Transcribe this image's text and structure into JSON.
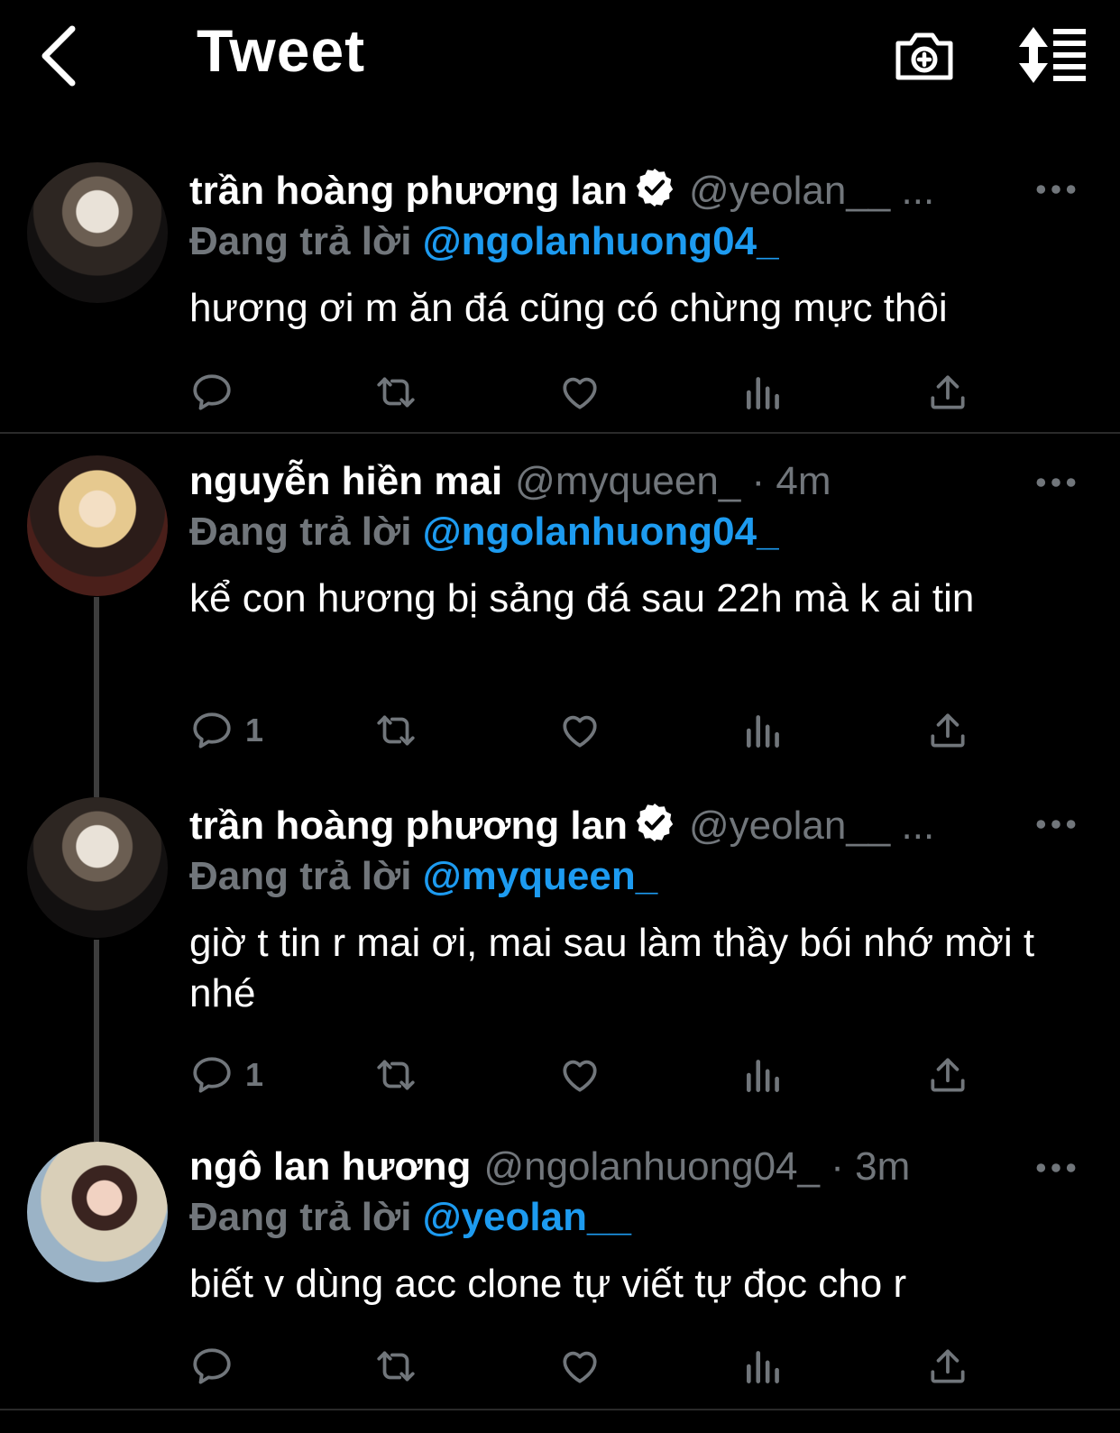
{
  "header": {
    "title": "Tweet"
  },
  "tweets": [
    {
      "name": "trần hoàng phương lan",
      "verified": true,
      "handle_time": "@yeolan__ ...",
      "reply_prefix": "Đang trả lời",
      "reply_to": "@ngolanhuong04_",
      "text": "hương ơi m ăn đá cũng có chừng mực thôi",
      "reply_count": ""
    },
    {
      "name": "nguyễn hiền mai",
      "verified": false,
      "handle_time": "@myqueen_ · 4m",
      "reply_prefix": "Đang trả lời",
      "reply_to": "@ngolanhuong04_",
      "text": "kể con hương bị sảng đá sau 22h mà k ai tin",
      "reply_count": "1"
    },
    {
      "name": "trần hoàng phương lan",
      "verified": true,
      "handle_time": "@yeolan__ ...",
      "reply_prefix": "Đang trả lời",
      "reply_to": "@myqueen_",
      "text": "giờ t tin r mai ơi, mai sau làm thầy bói nhớ mời t nhé",
      "reply_count": "1"
    },
    {
      "name": "ngô lan hương",
      "verified": false,
      "handle_time": "@ngolanhuong04_ · 3m",
      "reply_prefix": "Đang trả lời",
      "reply_to": "@yeolan__",
      "text": "biết v dùng acc clone tự viết tự đọc cho r",
      "reply_count": ""
    }
  ],
  "icons": [
    "back-arrow-icon",
    "camera-plus-icon",
    "sort-icon",
    "verified-badge-icon",
    "more-icon",
    "reply-icon",
    "retweet-icon",
    "like-icon",
    "views-icon",
    "share-icon"
  ],
  "colors": {
    "background": "#000000",
    "link": "#1d9bf0",
    "muted": "#71767b"
  }
}
